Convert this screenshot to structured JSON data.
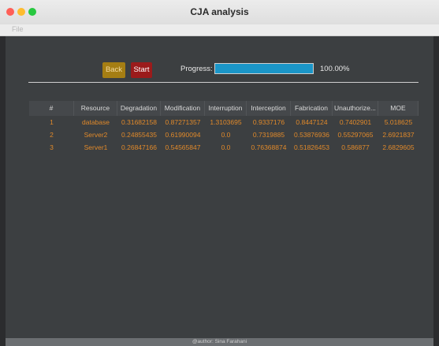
{
  "window": {
    "title": "CJA analysis"
  },
  "menu": {
    "file": "File"
  },
  "controls": {
    "back_label": "Back",
    "start_label": "Start",
    "progress_label": "Progress:",
    "progress_value": 1.0,
    "progress_text": "100.00%"
  },
  "table": {
    "headers": [
      "#",
      "Resource",
      "Degradation",
      "Modification",
      "Interruption",
      "Interception",
      "Fabrication",
      "Unauthorize...",
      "MOE"
    ],
    "rows": [
      [
        "1",
        "database",
        "0.31682158",
        "0.87271357",
        "1.3103695",
        "0.9337176",
        "0.8447124",
        "0.7402901",
        "5.018625"
      ],
      [
        "2",
        "Server2",
        "0.24855435",
        "0.61990094",
        "0.0",
        "0.7319885",
        "0.53876936",
        "0.55297065",
        "2.6921837"
      ],
      [
        "3",
        "Server1",
        "0.26847166",
        "0.54565847",
        "0.0",
        "0.76368874",
        "0.51826453",
        "0.586877",
        "2.6829605"
      ]
    ]
  },
  "footer": {
    "text": "@author: Sina Farahani"
  },
  "colors": {
    "accent_value": "#e0892a",
    "progress": "#1b96c8",
    "back": "#a57e13",
    "start": "#9b1b1b"
  }
}
